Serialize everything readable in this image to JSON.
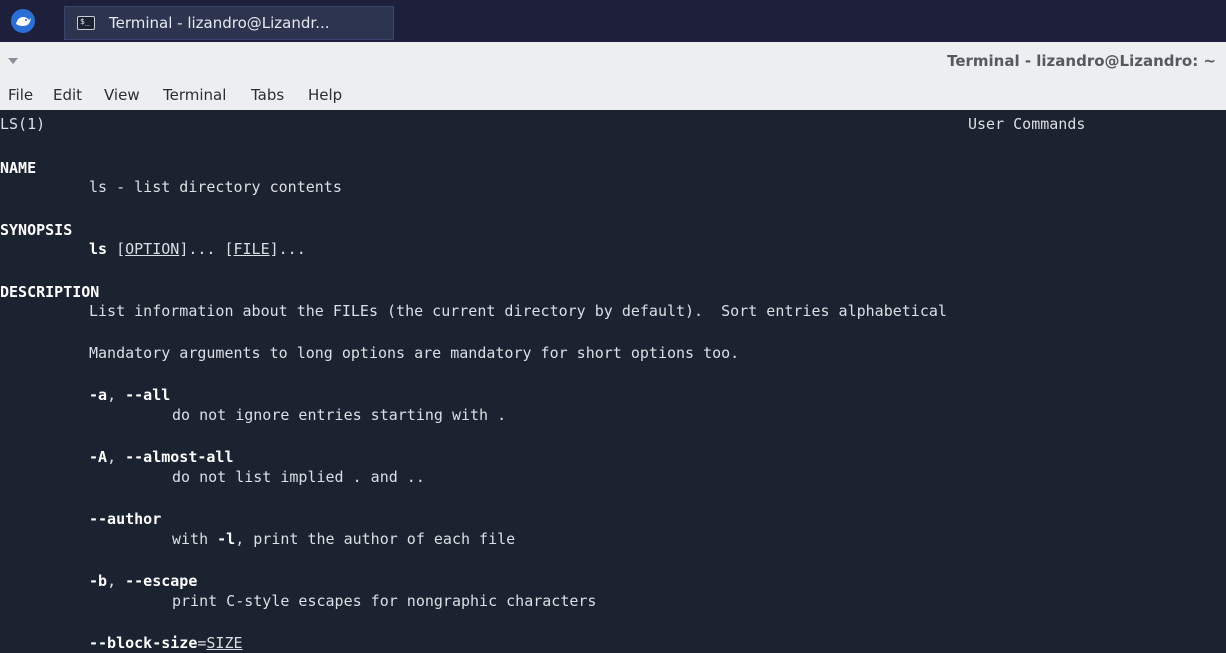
{
  "taskbar": {
    "task_label": "Terminal - lizandro@Lizandr...",
    "task_icon_glyph": "$_"
  },
  "window": {
    "title": "Terminal - lizandro@Lizandro: ~"
  },
  "menu": [
    "File",
    "Edit",
    "View",
    "Terminal",
    "Tabs",
    "Help"
  ],
  "man": {
    "header_left": "LS(1)",
    "header_right": "User Commands",
    "name_heading": "NAME",
    "name_text": "ls - list directory contents",
    "synopsis_heading": "SYNOPSIS",
    "synopsis_cmd": "ls",
    "synopsis_sp": " ",
    "synopsis_lb": "[",
    "synopsis_option": "OPTION",
    "synopsis_mid": "]... [",
    "synopsis_file": "FILE",
    "synopsis_end": "]...",
    "description_heading": "DESCRIPTION",
    "desc_line1": "List information about the FILEs (the current directory by default).  Sort entries alphabetical",
    "desc_line2": "Mandatory arguments to long options are mandatory for short options too.",
    "opt_a_short": "-a",
    "opt_comma": ", ",
    "opt_a_long": "--all",
    "opt_a_desc": "do not ignore entries starting with .",
    "opt_A_short": "-A",
    "opt_A_long": "--almost-all",
    "opt_A_desc": "do not list implied . and ..",
    "opt_author": "--author",
    "opt_author_pre": "with ",
    "opt_author_flag": "-l",
    "opt_author_post": ", print the author of each file",
    "opt_b_short": "-b",
    "opt_b_long": "--escape",
    "opt_b_desc": "print C-style escapes for nongraphic characters",
    "opt_bs_long": "--block-size",
    "opt_bs_eq": "=",
    "opt_bs_arg": "SIZE"
  }
}
